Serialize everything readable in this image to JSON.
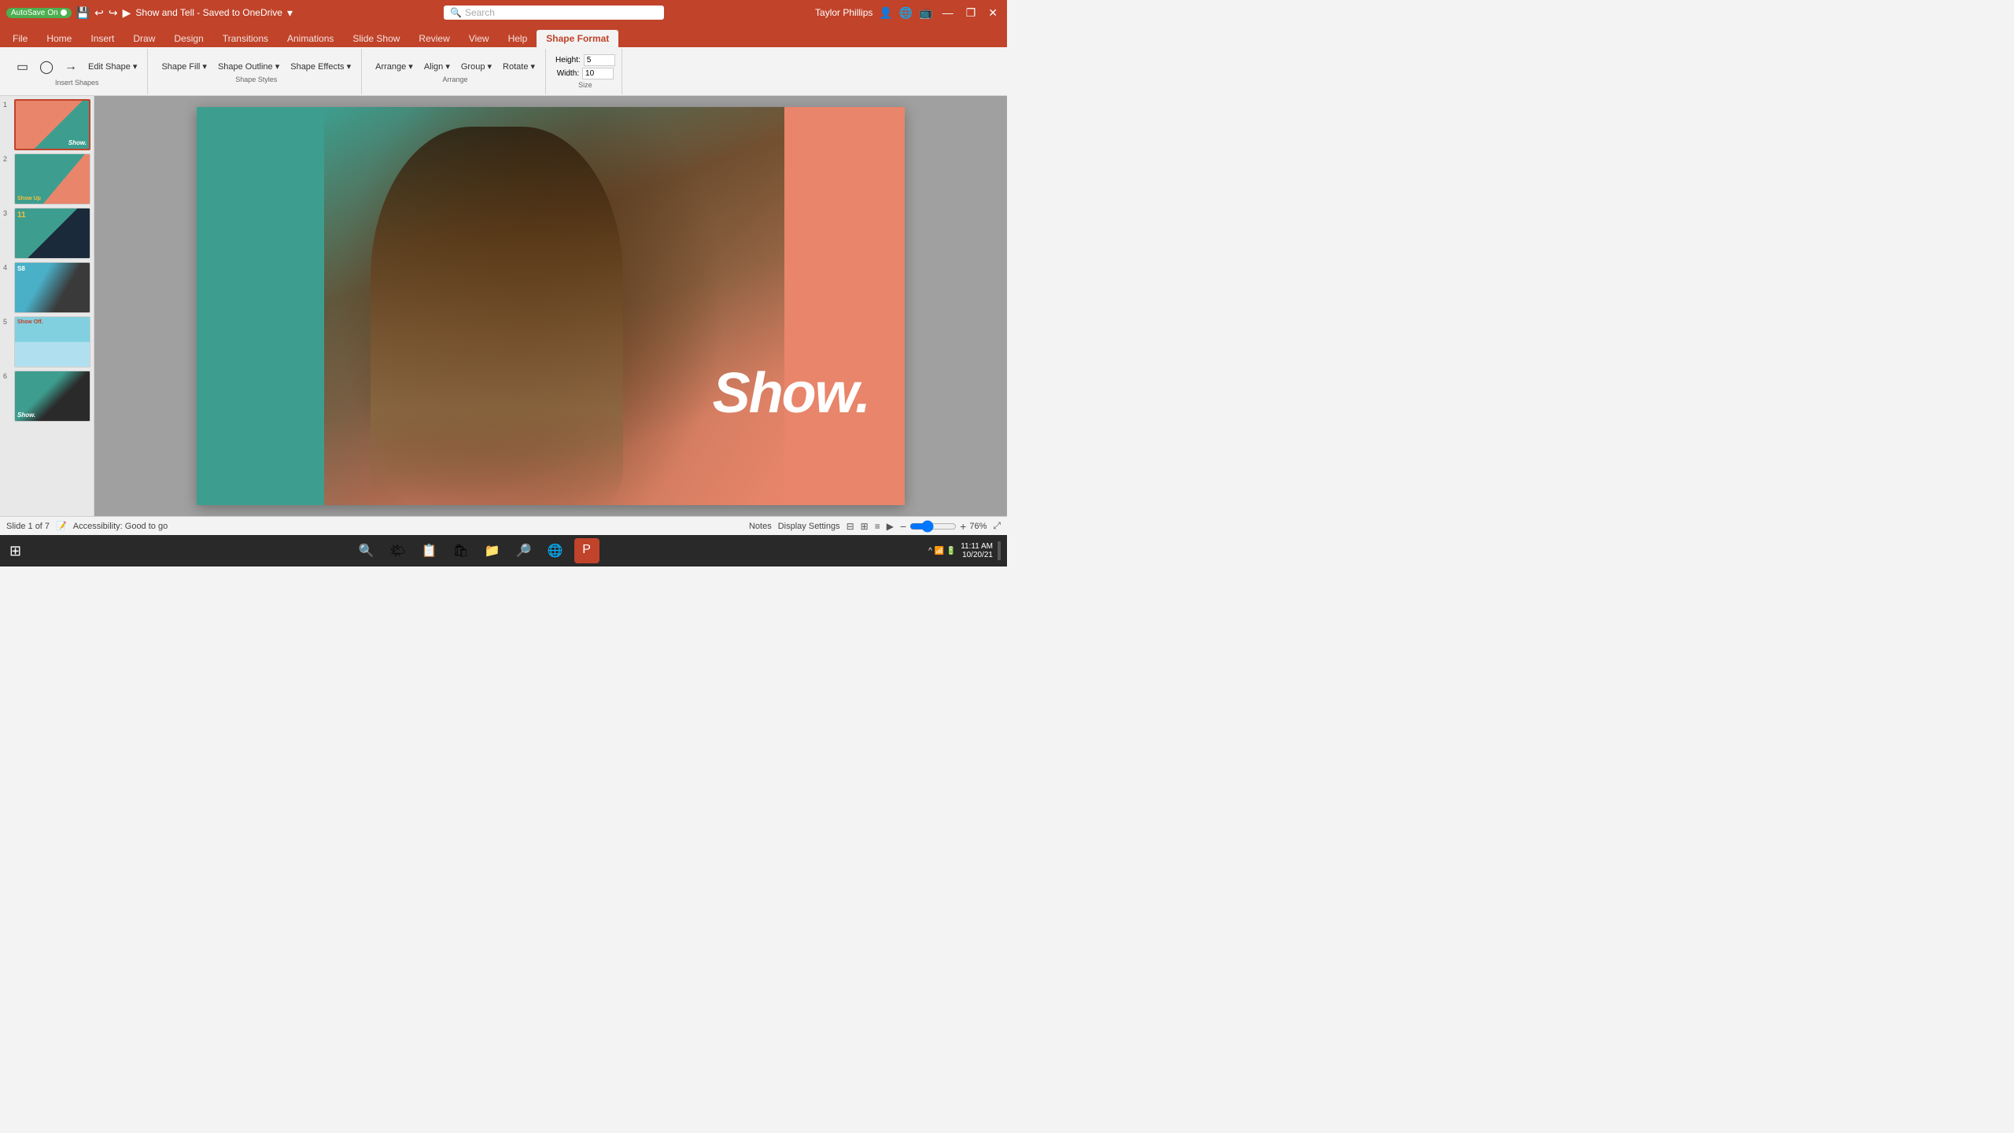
{
  "titlebar": {
    "autosave_label": "AutoSave",
    "autosave_state": "On",
    "file_title": "Show and Tell - Saved to OneDrive",
    "search_placeholder": "Search",
    "user_name": "Taylor Phillips",
    "minimize": "—",
    "restore": "❐",
    "close": "✕"
  },
  "tabs": [
    {
      "label": "File",
      "active": false
    },
    {
      "label": "Home",
      "active": false
    },
    {
      "label": "Insert",
      "active": false
    },
    {
      "label": "Draw",
      "active": false
    },
    {
      "label": "Design",
      "active": false
    },
    {
      "label": "Transitions",
      "active": false
    },
    {
      "label": "Animations",
      "active": false
    },
    {
      "label": "Slide Show",
      "active": false
    },
    {
      "label": "Review",
      "active": false
    },
    {
      "label": "View",
      "active": false
    },
    {
      "label": "Help",
      "active": false
    },
    {
      "label": "Shape Format",
      "active": true
    }
  ],
  "slides": [
    {
      "number": "1",
      "selected": true,
      "text": "Show."
    },
    {
      "number": "2",
      "selected": false,
      "text": "Show Up"
    },
    {
      "number": "3",
      "selected": false,
      "text": "11"
    },
    {
      "number": "4",
      "selected": false,
      "text": "S8"
    },
    {
      "number": "5",
      "selected": false,
      "text": "Show Off."
    },
    {
      "number": "6",
      "selected": false,
      "text": "Show."
    }
  ],
  "slide_content": {
    "main_text": "Show."
  },
  "status": {
    "slide_info": "Slide 1 of 7",
    "accessibility": "Accessibility: Good to go",
    "notes_label": "Notes",
    "display_settings_label": "Display Settings",
    "zoom_percent": "76%"
  },
  "taskbar": {
    "time": "11:11 AM",
    "date": "10/20/21"
  }
}
